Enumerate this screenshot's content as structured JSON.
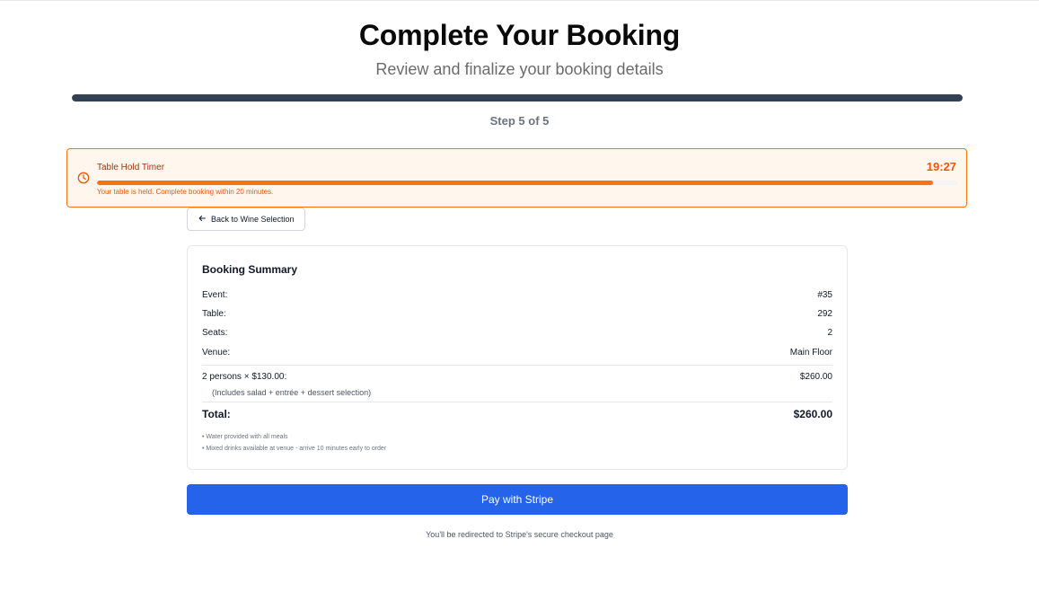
{
  "header": {
    "title": "Complete Your Booking",
    "subtitle": "Review and finalize your booking details"
  },
  "progress": {
    "step_label": "Step 5 of 5",
    "fraction": 1.0
  },
  "timer": {
    "title": "Table Hold Timer",
    "time": "19:27",
    "note": "Your table is held. Complete booking within 20 minutes.",
    "remaining_fraction": 0.972,
    "icon": "clock-icon"
  },
  "back_button": {
    "label": "Back to Wine Selection",
    "icon": "arrow-left-icon"
  },
  "summary": {
    "title": "Booking Summary",
    "details": [
      {
        "label": "Event:",
        "value": "#35"
      },
      {
        "label": "Table:",
        "value": "292"
      },
      {
        "label": "Seats:",
        "value": "2"
      },
      {
        "label": "Venue:",
        "value": "Main Floor"
      }
    ],
    "line_item": {
      "label": "2 persons × $130.00:",
      "value": "$260.00"
    },
    "includes": "(Includes salad + entrée + dessert selection)",
    "total": {
      "label": "Total:",
      "value": "$260.00"
    },
    "notes": [
      "• Water provided with all meals",
      "• Mixed drinks available at venue - arrive 10 minutes early to order"
    ]
  },
  "pay_button": {
    "label": "Pay with Stripe"
  },
  "redirect_note": "You'll be redirected to Stripe's secure checkout page",
  "colors": {
    "accent": "#2563eb",
    "timer_orange": "#f97316",
    "progress_dark": "#334155"
  }
}
